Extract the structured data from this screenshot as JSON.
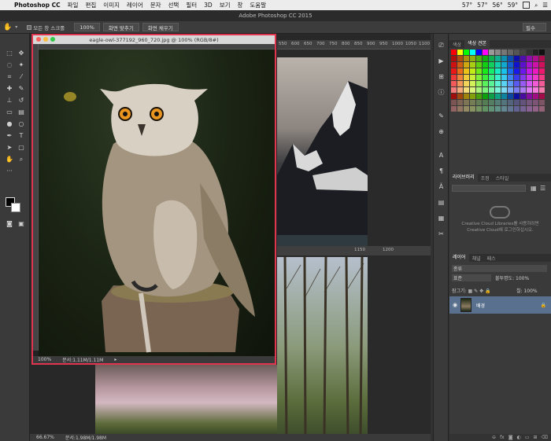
{
  "menubar": {
    "app_name": "Photoshop CC",
    "items": [
      "파일",
      "편집",
      "이미지",
      "레이어",
      "문자",
      "선택",
      "필터",
      "3D",
      "보기",
      "창",
      "도움말"
    ],
    "status": [
      "57°",
      "57°",
      "56°",
      "59°"
    ]
  },
  "window_title": "Adobe Photoshop CC 2015",
  "options_bar": {
    "scroll_all": "모든 창 스크롤",
    "zoom_100": "100%",
    "fit_screen": "화면 맞추기",
    "fill_screen": "화면 채우기",
    "workspace": "필수"
  },
  "document": {
    "title": "eagle-owl-377192_960_720.jpg @ 100% (RGB/8#)",
    "zoom": "100%",
    "doc_size": "문서:1.11M/1.11M"
  },
  "document2": {
    "ruler_ticks": [
      "550",
      "600",
      "650",
      "700",
      "750",
      "800",
      "850",
      "900",
      "950",
      "1000",
      "1050",
      "1100"
    ],
    "lower_ruler_ticks": [
      "1150",
      "1200"
    ],
    "zoom": "66.67%",
    "doc_size": "문서:1.98M/1.98M"
  },
  "panels": {
    "color_tabs": [
      "색상",
      "색상 견본"
    ],
    "library_tabs": [
      "라이브러리",
      "조정",
      "스타일"
    ],
    "library_message": "Creative Cloud Libraries를 사용하려면 Creative Cloud에 로그인하십시오.",
    "layer_tabs": [
      "레이어",
      "채널",
      "패스"
    ],
    "filter_label": "종류",
    "blend_mode": "표준",
    "opacity_label": "불투명도:",
    "opacity_value": "100%",
    "lock_label": "잠그기:",
    "fill_label": "칠:",
    "fill_value": "100%",
    "layer_name": "배경"
  },
  "colors": {
    "accent": "#e0344f",
    "layer_selected": "#59708f"
  }
}
